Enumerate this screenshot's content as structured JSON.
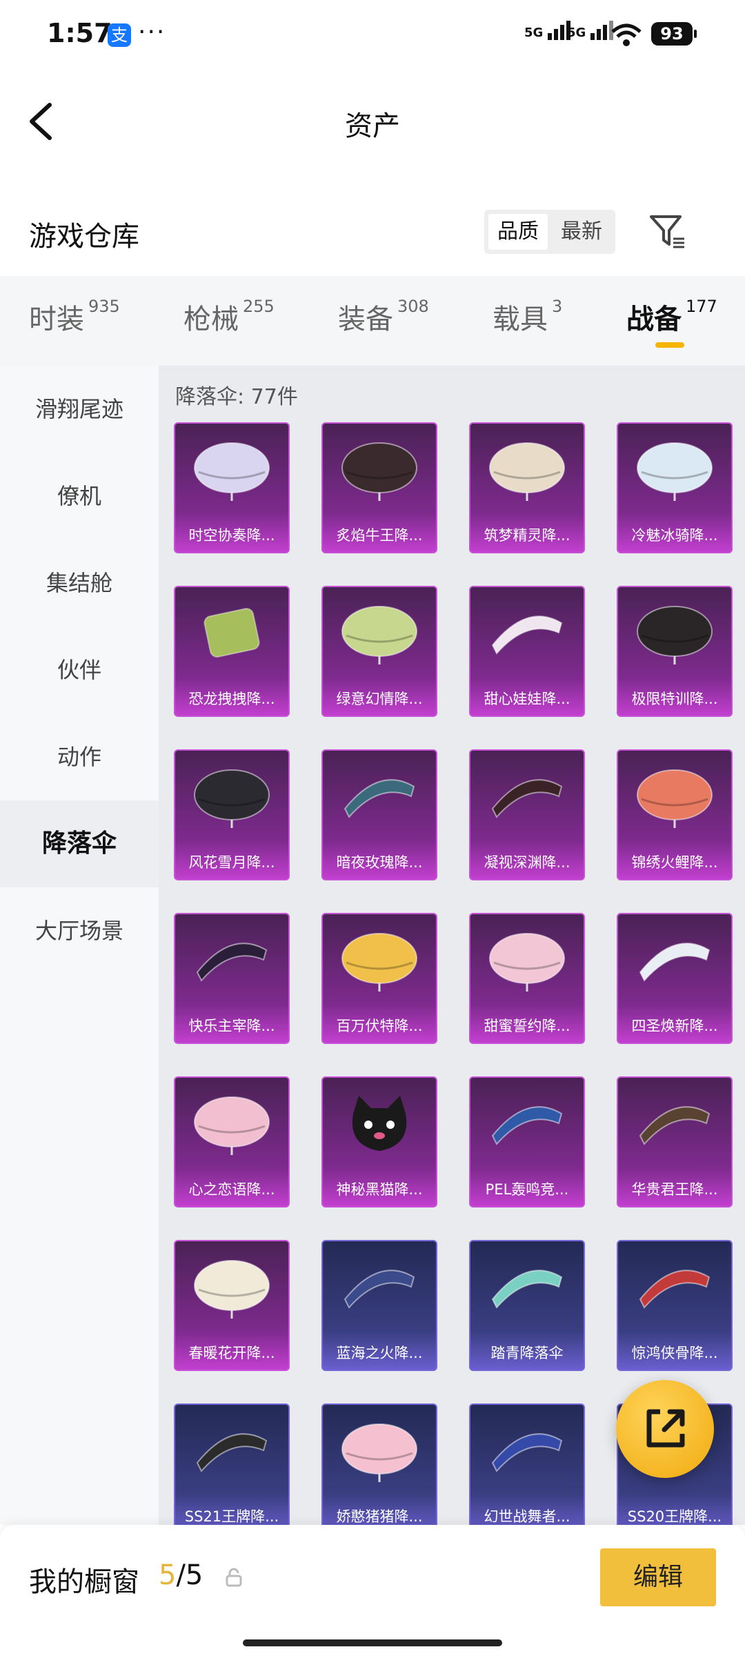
{
  "status_bar": {
    "time": "1:57",
    "app_badge": "支",
    "more": "···",
    "signal1": "5G",
    "signal2": "5G",
    "battery": "93"
  },
  "header": {
    "title": "资产"
  },
  "section": {
    "title": "游戏仓库",
    "sort": [
      "品质",
      "最新"
    ]
  },
  "tabs": [
    {
      "label": "时装",
      "count": "935"
    },
    {
      "label": "枪械",
      "count": "255"
    },
    {
      "label": "装备",
      "count": "308"
    },
    {
      "label": "载具",
      "count": "3"
    },
    {
      "label": "战备",
      "count": "177"
    }
  ],
  "sidebar": {
    "items": [
      {
        "label": "滑翔尾迹"
      },
      {
        "label": "僚机"
      },
      {
        "label": "集结舱"
      },
      {
        "label": "伙伴"
      },
      {
        "label": "动作"
      },
      {
        "label": "降落伞"
      },
      {
        "label": "大厅场景"
      }
    ]
  },
  "grid": {
    "heading": "降落伞: 77件",
    "items": [
      {
        "name": "时空协奏降...",
        "rarity": "purple",
        "icon": "parachute-canopy-icon"
      },
      {
        "name": "炙焰牛王降...",
        "rarity": "purple",
        "icon": "parachute-canopy-icon"
      },
      {
        "name": "筑梦精灵降...",
        "rarity": "purple",
        "icon": "parachute-canopy-icon"
      },
      {
        "name": "冷魅冰骑降...",
        "rarity": "purple",
        "icon": "parachute-canopy-icon"
      },
      {
        "name": "恐龙拽拽降...",
        "rarity": "purple",
        "icon": "parachute-box-icon"
      },
      {
        "name": "绿意幻情降...",
        "rarity": "purple",
        "icon": "parachute-canopy-icon"
      },
      {
        "name": "甜心娃娃降...",
        "rarity": "purple",
        "icon": "parachute-wing-icon"
      },
      {
        "name": "极限特训降...",
        "rarity": "purple",
        "icon": "parachute-canopy-icon"
      },
      {
        "name": "风花雪月降...",
        "rarity": "purple",
        "icon": "parachute-canopy-icon"
      },
      {
        "name": "暗夜玫瑰降...",
        "rarity": "purple",
        "icon": "parachute-wing-icon"
      },
      {
        "name": "凝视深渊降...",
        "rarity": "purple",
        "icon": "parachute-wing-icon"
      },
      {
        "name": "锦绣火鲤降...",
        "rarity": "purple",
        "icon": "parachute-canopy-icon"
      },
      {
        "name": "快乐主宰降...",
        "rarity": "purple",
        "icon": "parachute-wing-icon"
      },
      {
        "name": "百万伏特降...",
        "rarity": "purple",
        "icon": "parachute-canopy-icon"
      },
      {
        "name": "甜蜜誓约降...",
        "rarity": "purple",
        "icon": "parachute-canopy-icon"
      },
      {
        "name": "四圣焕新降...",
        "rarity": "purple",
        "icon": "parachute-wing-icon"
      },
      {
        "name": "心之恋语降...",
        "rarity": "purple",
        "icon": "parachute-canopy-icon"
      },
      {
        "name": "神秘黑猫降...",
        "rarity": "purple",
        "icon": "parachute-cat-icon"
      },
      {
        "name": "PEL轰鸣竞...",
        "rarity": "purple",
        "icon": "parachute-wing-icon"
      },
      {
        "name": "华贵君王降...",
        "rarity": "purple",
        "icon": "parachute-wing-icon"
      },
      {
        "name": "春暖花开降...",
        "rarity": "purple",
        "icon": "parachute-canopy-icon"
      },
      {
        "name": "蓝海之火降...",
        "rarity": "blue",
        "icon": "parachute-wing-icon"
      },
      {
        "name": "踏青降落伞",
        "rarity": "blue",
        "icon": "parachute-wing-icon"
      },
      {
        "name": "惊鸿侠骨降...",
        "rarity": "blue",
        "icon": "parachute-wing-icon"
      },
      {
        "name": "SS21王牌降...",
        "rarity": "blue",
        "icon": "parachute-wing-icon"
      },
      {
        "name": "娇憨猪猪降...",
        "rarity": "blue",
        "icon": "parachute-canopy-icon"
      },
      {
        "name": "幻世战舞者...",
        "rarity": "blue",
        "icon": "parachute-wing-icon"
      },
      {
        "name": "SS20王牌降...",
        "rarity": "blue",
        "icon": "parachute-wing-icon"
      }
    ]
  },
  "showcase": {
    "title": "我的橱窗",
    "current": "5",
    "total": "/5",
    "edit_label": "编辑"
  },
  "colors": {
    "accent": "#f2bf3c",
    "purple_tile": "#7e2a8e",
    "blue_tile": "#3a3e82"
  }
}
